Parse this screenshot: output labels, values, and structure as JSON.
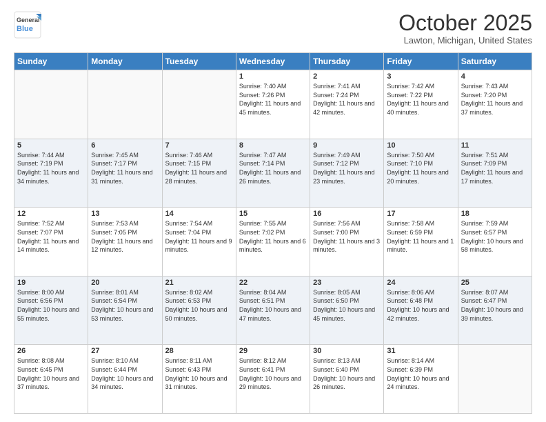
{
  "header": {
    "logo_line1": "General",
    "logo_line2": "Blue",
    "month": "October 2025",
    "location": "Lawton, Michigan, United States"
  },
  "weekdays": [
    "Sunday",
    "Monday",
    "Tuesday",
    "Wednesday",
    "Thursday",
    "Friday",
    "Saturday"
  ],
  "weeks": [
    [
      {
        "day": "",
        "sunrise": "",
        "sunset": "",
        "daylight": ""
      },
      {
        "day": "",
        "sunrise": "",
        "sunset": "",
        "daylight": ""
      },
      {
        "day": "",
        "sunrise": "",
        "sunset": "",
        "daylight": ""
      },
      {
        "day": "1",
        "sunrise": "Sunrise: 7:40 AM",
        "sunset": "Sunset: 7:26 PM",
        "daylight": "Daylight: 11 hours and 45 minutes."
      },
      {
        "day": "2",
        "sunrise": "Sunrise: 7:41 AM",
        "sunset": "Sunset: 7:24 PM",
        "daylight": "Daylight: 11 hours and 42 minutes."
      },
      {
        "day": "3",
        "sunrise": "Sunrise: 7:42 AM",
        "sunset": "Sunset: 7:22 PM",
        "daylight": "Daylight: 11 hours and 40 minutes."
      },
      {
        "day": "4",
        "sunrise": "Sunrise: 7:43 AM",
        "sunset": "Sunset: 7:20 PM",
        "daylight": "Daylight: 11 hours and 37 minutes."
      }
    ],
    [
      {
        "day": "5",
        "sunrise": "Sunrise: 7:44 AM",
        "sunset": "Sunset: 7:19 PM",
        "daylight": "Daylight: 11 hours and 34 minutes."
      },
      {
        "day": "6",
        "sunrise": "Sunrise: 7:45 AM",
        "sunset": "Sunset: 7:17 PM",
        "daylight": "Daylight: 11 hours and 31 minutes."
      },
      {
        "day": "7",
        "sunrise": "Sunrise: 7:46 AM",
        "sunset": "Sunset: 7:15 PM",
        "daylight": "Daylight: 11 hours and 28 minutes."
      },
      {
        "day": "8",
        "sunrise": "Sunrise: 7:47 AM",
        "sunset": "Sunset: 7:14 PM",
        "daylight": "Daylight: 11 hours and 26 minutes."
      },
      {
        "day": "9",
        "sunrise": "Sunrise: 7:49 AM",
        "sunset": "Sunset: 7:12 PM",
        "daylight": "Daylight: 11 hours and 23 minutes."
      },
      {
        "day": "10",
        "sunrise": "Sunrise: 7:50 AM",
        "sunset": "Sunset: 7:10 PM",
        "daylight": "Daylight: 11 hours and 20 minutes."
      },
      {
        "day": "11",
        "sunrise": "Sunrise: 7:51 AM",
        "sunset": "Sunset: 7:09 PM",
        "daylight": "Daylight: 11 hours and 17 minutes."
      }
    ],
    [
      {
        "day": "12",
        "sunrise": "Sunrise: 7:52 AM",
        "sunset": "Sunset: 7:07 PM",
        "daylight": "Daylight: 11 hours and 14 minutes."
      },
      {
        "day": "13",
        "sunrise": "Sunrise: 7:53 AM",
        "sunset": "Sunset: 7:05 PM",
        "daylight": "Daylight: 11 hours and 12 minutes."
      },
      {
        "day": "14",
        "sunrise": "Sunrise: 7:54 AM",
        "sunset": "Sunset: 7:04 PM",
        "daylight": "Daylight: 11 hours and 9 minutes."
      },
      {
        "day": "15",
        "sunrise": "Sunrise: 7:55 AM",
        "sunset": "Sunset: 7:02 PM",
        "daylight": "Daylight: 11 hours and 6 minutes."
      },
      {
        "day": "16",
        "sunrise": "Sunrise: 7:56 AM",
        "sunset": "Sunset: 7:00 PM",
        "daylight": "Daylight: 11 hours and 3 minutes."
      },
      {
        "day": "17",
        "sunrise": "Sunrise: 7:58 AM",
        "sunset": "Sunset: 6:59 PM",
        "daylight": "Daylight: 11 hours and 1 minute."
      },
      {
        "day": "18",
        "sunrise": "Sunrise: 7:59 AM",
        "sunset": "Sunset: 6:57 PM",
        "daylight": "Daylight: 10 hours and 58 minutes."
      }
    ],
    [
      {
        "day": "19",
        "sunrise": "Sunrise: 8:00 AM",
        "sunset": "Sunset: 6:56 PM",
        "daylight": "Daylight: 10 hours and 55 minutes."
      },
      {
        "day": "20",
        "sunrise": "Sunrise: 8:01 AM",
        "sunset": "Sunset: 6:54 PM",
        "daylight": "Daylight: 10 hours and 53 minutes."
      },
      {
        "day": "21",
        "sunrise": "Sunrise: 8:02 AM",
        "sunset": "Sunset: 6:53 PM",
        "daylight": "Daylight: 10 hours and 50 minutes."
      },
      {
        "day": "22",
        "sunrise": "Sunrise: 8:04 AM",
        "sunset": "Sunset: 6:51 PM",
        "daylight": "Daylight: 10 hours and 47 minutes."
      },
      {
        "day": "23",
        "sunrise": "Sunrise: 8:05 AM",
        "sunset": "Sunset: 6:50 PM",
        "daylight": "Daylight: 10 hours and 45 minutes."
      },
      {
        "day": "24",
        "sunrise": "Sunrise: 8:06 AM",
        "sunset": "Sunset: 6:48 PM",
        "daylight": "Daylight: 10 hours and 42 minutes."
      },
      {
        "day": "25",
        "sunrise": "Sunrise: 8:07 AM",
        "sunset": "Sunset: 6:47 PM",
        "daylight": "Daylight: 10 hours and 39 minutes."
      }
    ],
    [
      {
        "day": "26",
        "sunrise": "Sunrise: 8:08 AM",
        "sunset": "Sunset: 6:45 PM",
        "daylight": "Daylight: 10 hours and 37 minutes."
      },
      {
        "day": "27",
        "sunrise": "Sunrise: 8:10 AM",
        "sunset": "Sunset: 6:44 PM",
        "daylight": "Daylight: 10 hours and 34 minutes."
      },
      {
        "day": "28",
        "sunrise": "Sunrise: 8:11 AM",
        "sunset": "Sunset: 6:43 PM",
        "daylight": "Daylight: 10 hours and 31 minutes."
      },
      {
        "day": "29",
        "sunrise": "Sunrise: 8:12 AM",
        "sunset": "Sunset: 6:41 PM",
        "daylight": "Daylight: 10 hours and 29 minutes."
      },
      {
        "day": "30",
        "sunrise": "Sunrise: 8:13 AM",
        "sunset": "Sunset: 6:40 PM",
        "daylight": "Daylight: 10 hours and 26 minutes."
      },
      {
        "day": "31",
        "sunrise": "Sunrise: 8:14 AM",
        "sunset": "Sunset: 6:39 PM",
        "daylight": "Daylight: 10 hours and 24 minutes."
      },
      {
        "day": "",
        "sunrise": "",
        "sunset": "",
        "daylight": ""
      }
    ]
  ]
}
